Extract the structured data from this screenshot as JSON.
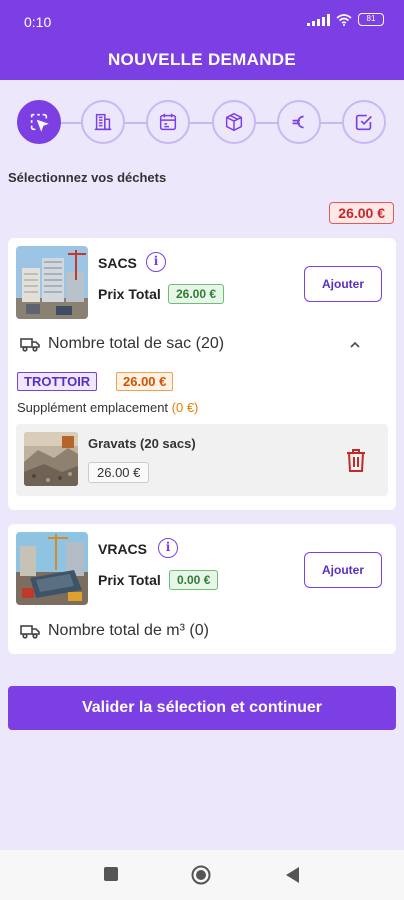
{
  "status_bar": {
    "time": "0:10",
    "battery": "81"
  },
  "header": {
    "title": "NOUVELLE DEMANDE"
  },
  "stepper": {
    "steps": [
      {
        "icon": "select-cursor-icon",
        "active": true
      },
      {
        "icon": "building-icon",
        "active": false
      },
      {
        "icon": "calendar-icon",
        "active": false
      },
      {
        "icon": "package-icon",
        "active": false
      },
      {
        "icon": "euro-icon",
        "active": false
      },
      {
        "icon": "checkbox-icon",
        "active": false
      }
    ]
  },
  "section": {
    "title": "Sélectionnez vos déchets",
    "total": "26.00 €"
  },
  "sacs": {
    "name": "SACS",
    "price_label": "Prix Total",
    "price": "26.00 €",
    "add_label": "Ajouter",
    "count_text": "Nombre total de sac (20)",
    "location_tag": "TROTTOIR",
    "location_price": "26.00 €",
    "supplement_label": "Supplément emplacement",
    "supplement_value": "(0 €)",
    "item": {
      "name": "Gravats (20 sacs)",
      "price": "26.00 €"
    }
  },
  "vracs": {
    "name": "VRACS",
    "price_label": "Prix Total",
    "price": "0.00 €",
    "add_label": "Ajouter",
    "count_text": "Nombre total de m³ (0)"
  },
  "validate_label": "Valider la sélection et continuer",
  "colors": {
    "primary": "#7b3fe4",
    "total_red": "#c62828",
    "price_green": "#2e7d32",
    "orange": "#e67e00"
  }
}
